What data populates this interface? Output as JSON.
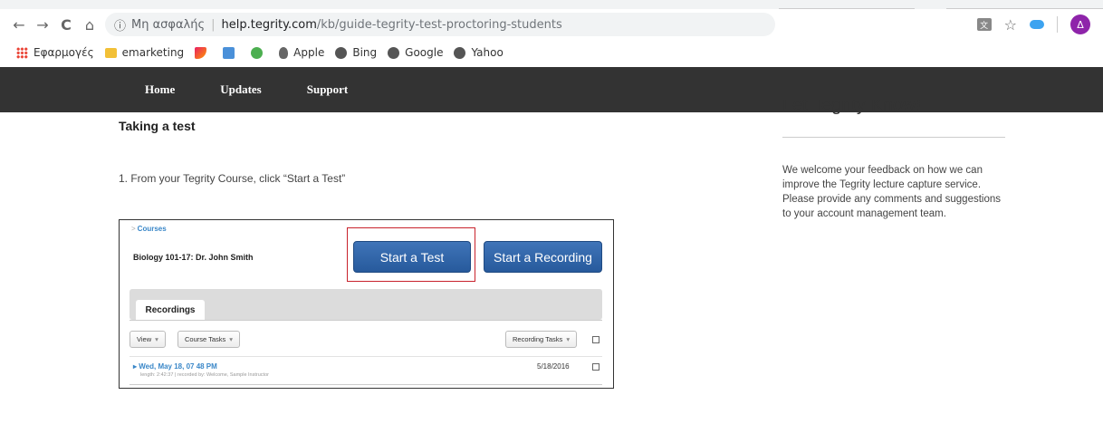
{
  "browser": {
    "nav": {
      "back": "←",
      "forward": "→",
      "reload": "C",
      "home": "⌂"
    },
    "address": {
      "security_label": "Μη ασφαλής",
      "separator": "|",
      "host": "help.tegrity.com",
      "path": "/kb/guide-tegrity-test-proctoring-students"
    },
    "profile_initial": "Δ",
    "bookmarks": [
      {
        "label": "Εφαρμογές",
        "icon": "apps-icon"
      },
      {
        "label": "emarketing",
        "icon": "folder-icon"
      },
      {
        "label": "Apple",
        "icon": "apple-icon"
      },
      {
        "label": "Bing",
        "icon": "globe-icon"
      },
      {
        "label": "Google",
        "icon": "globe-icon"
      },
      {
        "label": "Yahoo",
        "icon": "globe-icon"
      }
    ]
  },
  "site_nav": {
    "home": "Home",
    "updates": "Updates",
    "support": "Support"
  },
  "content": {
    "heading": "Taking a test",
    "step1": "1. From your Tegrity Course, click “Start a Test”"
  },
  "screenshot": {
    "breadcrumb_marker": ">",
    "breadcrumb": "Courses",
    "course_title": "Biology 101-17: Dr. John Smith",
    "start_test": "Start a Test",
    "start_recording": "Start a Recording",
    "tab_recordings": "Recordings",
    "view_btn": "View",
    "course_tasks_btn": "Course Tasks",
    "recording_tasks_btn": "Recording Tasks",
    "dropdown_caret": "▾",
    "row_marker": "▸",
    "recording_title": "Wed, May 18, 07 48 PM",
    "recording_meta": "length: 2:42:37 | recorded by: Welcome, Sample Instructor",
    "recording_date": "5/18/2016"
  },
  "sidebar": {
    "title": "Let Tegrity Know!",
    "body": "We welcome your feedback on how we can improve the Tegrity lecture capture service. Please provide any comments and suggestions to your account management team."
  }
}
